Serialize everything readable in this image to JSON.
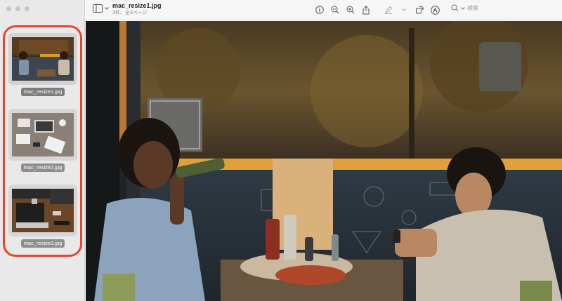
{
  "window": {
    "title": "mac_resize1.jpg",
    "subtitle": "3件、全3ページ"
  },
  "sidebar": {
    "thumbnails": [
      {
        "label": "mac_resize1.jpg",
        "selected": true
      },
      {
        "label": "mac_resize2.jpg",
        "selected": false
      },
      {
        "label": "mac_resize3.jpg",
        "selected": false
      }
    ],
    "highlight_color": "#e8452c"
  },
  "toolbar": {
    "icons": [
      "sidebar-toggle-icon",
      "info-icon",
      "zoom-out-icon",
      "zoom-in-icon",
      "share-icon",
      "markup-icon",
      "rotate-icon",
      "annotate-icon",
      "search-icon"
    ],
    "search_placeholder": "検索"
  }
}
